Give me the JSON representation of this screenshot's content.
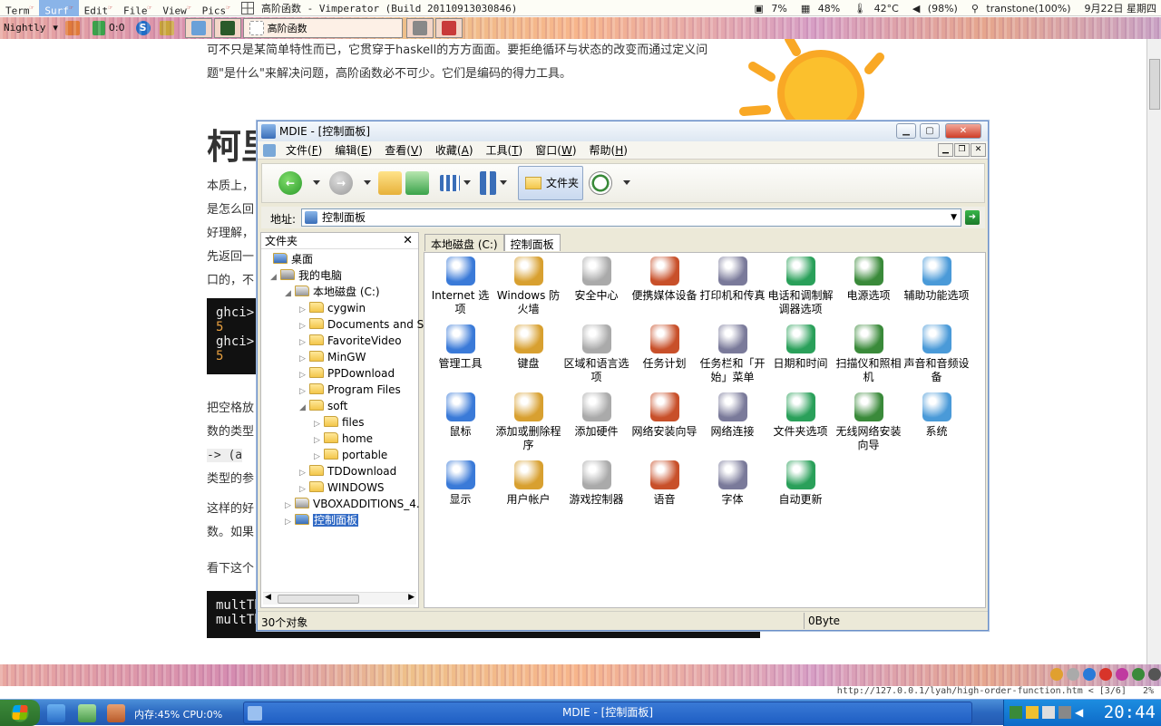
{
  "topbar": {
    "menus": [
      "Term",
      "Surf",
      "Edit",
      "File",
      "View",
      "Pics"
    ],
    "title": "高阶函数 - Vimperator (Build 20110913030846)",
    "status": {
      "cpu": "7%",
      "mem": "48%",
      "temp": "42°C",
      "vol": "(98%)",
      "net": "transtone(100%)",
      "date": "9月22日 星期四"
    }
  },
  "tabbar": {
    "profile": "Nightly",
    "counter": "0:0",
    "active_tab": "高阶函数"
  },
  "page": {
    "para1": "可不只是某简单特性而已，它贯穿于haskell的方方面面。要拒绝循环与状态的改变而通过定义问题\"是什么\"来解决问题，高阶函数必不可少。它们是编码的得力工具。",
    "heading": "柯里",
    "para2_lines": [
      "本质上，",
      "是怎么回",
      "好理解，",
      "先返回一",
      "口的，不"
    ],
    "code1": [
      "ghci>",
      "5",
      "ghci>",
      "5"
    ],
    "para3_lines": [
      "把空格放",
      "数的类型",
      "-> (a",
      "类型的参"
    ],
    "para4_lines": [
      "这样的好",
      "数。如果"
    ],
    "para5": "看下这个",
    "code2": [
      "multTh",
      "multTh"
    ]
  },
  "explorer": {
    "title": "MDIE - [控制面板]",
    "menus": [
      {
        "label": "文件",
        "key": "F"
      },
      {
        "label": "编辑",
        "key": "E"
      },
      {
        "label": "查看",
        "key": "V"
      },
      {
        "label": "收藏",
        "key": "A"
      },
      {
        "label": "工具",
        "key": "T"
      },
      {
        "label": "窗口",
        "key": "W"
      },
      {
        "label": "帮助",
        "key": "H"
      }
    ],
    "folder_button": "文件夹",
    "address_label": "地址:",
    "address_value": "控制面板",
    "folder_pane_title": "文件夹",
    "tree": [
      {
        "label": "桌面",
        "level": 0
      },
      {
        "label": "我的电脑",
        "level": 1
      },
      {
        "label": "本地磁盘 (C:)",
        "level": 2
      },
      {
        "label": "cygwin",
        "level": 3
      },
      {
        "label": "Documents and S",
        "level": 3
      },
      {
        "label": "FavoriteVideo",
        "level": 3
      },
      {
        "label": "MinGW",
        "level": 3
      },
      {
        "label": "PPDownload",
        "level": 3
      },
      {
        "label": "Program Files",
        "level": 3
      },
      {
        "label": "soft",
        "level": 3
      },
      {
        "label": "files",
        "level": 4
      },
      {
        "label": "home",
        "level": 4
      },
      {
        "label": "portable",
        "level": 4
      },
      {
        "label": "TDDownload",
        "level": 3
      },
      {
        "label": "WINDOWS",
        "level": 3
      },
      {
        "label": "VBOXADDITIONS_4. (",
        "level": 2
      },
      {
        "label": "控制面板",
        "level": 2
      }
    ],
    "tabs": [
      "本地磁盘 (C:)",
      "控制面板"
    ],
    "items": [
      {
        "label": "Internet 选项",
        "icon": "globe-doc-icon"
      },
      {
        "label": "Windows 防火墙",
        "icon": "firewall-icon"
      },
      {
        "label": "安全中心",
        "icon": "shield-icon"
      },
      {
        "label": "便携媒体设备",
        "icon": "media-device-icon"
      },
      {
        "label": "打印机和传真",
        "icon": "printer-icon"
      },
      {
        "label": "电话和调制解调器选项",
        "icon": "phone-modem-icon"
      },
      {
        "label": "电源选项",
        "icon": "power-icon"
      },
      {
        "label": "辅助功能选项",
        "icon": "accessibility-icon"
      },
      {
        "label": "管理工具",
        "icon": "admin-tools-icon"
      },
      {
        "label": "键盘",
        "icon": "keyboard-icon"
      },
      {
        "label": "区域和语言选项",
        "icon": "globe-icon"
      },
      {
        "label": "任务计划",
        "icon": "task-schedule-icon"
      },
      {
        "label": "任务栏和「开始」菜单",
        "icon": "taskbar-icon"
      },
      {
        "label": "日期和时间",
        "icon": "datetime-icon"
      },
      {
        "label": "扫描仪和照相机",
        "icon": "scanner-icon"
      },
      {
        "label": "声音和音频设备",
        "icon": "speaker-icon"
      },
      {
        "label": "鼠标",
        "icon": "mouse-icon"
      },
      {
        "label": "添加或删除程序",
        "icon": "add-remove-icon"
      },
      {
        "label": "添加硬件",
        "icon": "hardware-icon"
      },
      {
        "label": "网络安装向导",
        "icon": "network-wizard-icon"
      },
      {
        "label": "网络连接",
        "icon": "network-icon"
      },
      {
        "label": "文件夹选项",
        "icon": "folder-options-icon"
      },
      {
        "label": "无线网络安装向导",
        "icon": "wireless-icon"
      },
      {
        "label": "系统",
        "icon": "system-icon"
      },
      {
        "label": "显示",
        "icon": "display-icon"
      },
      {
        "label": "用户帐户",
        "icon": "users-icon"
      },
      {
        "label": "游戏控制器",
        "icon": "gamepad-icon"
      },
      {
        "label": "语音",
        "icon": "speech-icon"
      },
      {
        "label": "字体",
        "icon": "fonts-icon"
      },
      {
        "label": "自动更新",
        "icon": "windows-update-icon"
      }
    ],
    "status_count": "30个对象",
    "status_size": "0Byte"
  },
  "urlbar": "http://127.0.0.1/lyah/high-order-function.htm < [3/6]   2%",
  "taskbar": {
    "mem": "内存:45% CPU:0%",
    "task": "MDIE - [控制面板]",
    "clock": "20:44"
  }
}
